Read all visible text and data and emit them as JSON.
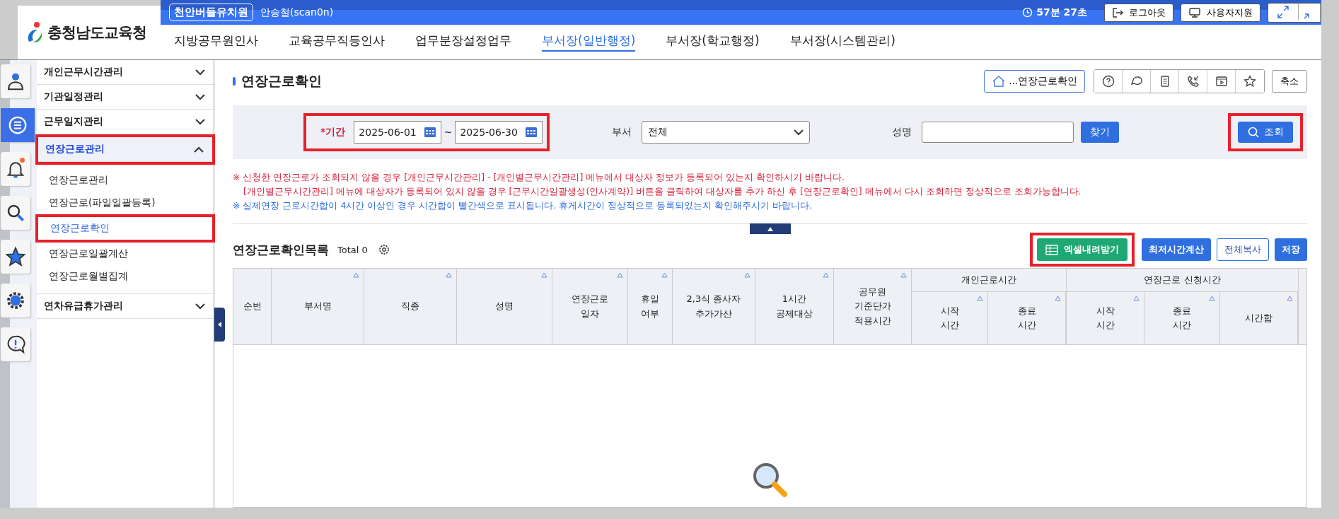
{
  "header": {
    "logo_text": "충청남도교육청",
    "org_badge": "천안버들유치원",
    "user": "안승철(scan0n)",
    "timer": "57분 27초",
    "buttons": [
      {
        "kind": "logout",
        "label": "로그아웃"
      },
      {
        "kind": "support",
        "label": "사용자지원"
      }
    ],
    "nav": [
      {
        "label": "지방공무원인사",
        "selected": false
      },
      {
        "label": "교육공무직등인사",
        "selected": false
      },
      {
        "label": "업무분장설정업무",
        "selected": false
      },
      {
        "label": "부서장(일반행정)",
        "selected": true
      },
      {
        "label": "부서장(학교행정)",
        "selected": false
      },
      {
        "label": "부서장(시스템관리)",
        "selected": false
      }
    ]
  },
  "rail": [
    {
      "kind": "person",
      "selected": false,
      "notification": false
    },
    {
      "kind": "list",
      "selected": true,
      "notification": false
    },
    {
      "kind": "bell",
      "selected": false,
      "notification": true
    },
    {
      "kind": "search",
      "selected": false,
      "notification": false
    },
    {
      "kind": "star",
      "selected": false,
      "notification": false
    },
    {
      "kind": "gear",
      "selected": false,
      "notification": false
    },
    {
      "kind": "alert",
      "selected": false,
      "notification": false
    }
  ],
  "menu": [
    {
      "label": "개인근무시간관리",
      "expanded": false,
      "highlighted": false
    },
    {
      "label": "기관일정관리",
      "expanded": false,
      "highlighted": false
    },
    {
      "label": "근무일지관리",
      "expanded": false,
      "highlighted": false
    },
    {
      "label": "연장근로관리",
      "expanded": true,
      "highlighted": true,
      "children": [
        {
          "label": "연장근로관리",
          "selected": false,
          "highlighted": false
        },
        {
          "label": "연장근로(파일일괄등록)",
          "selected": false,
          "highlighted": false
        },
        {
          "label": "연장근로확인",
          "selected": true,
          "highlighted": true
        },
        {
          "label": "연장근로일괄계산",
          "selected": false,
          "highlighted": false
        },
        {
          "label": "연장근로월별집계",
          "selected": false,
          "highlighted": false
        }
      ]
    },
    {
      "label": "연차유급휴가관리",
      "expanded": false,
      "highlighted": false
    }
  ],
  "page": {
    "title": "연장근로확인",
    "breadcrumb": "...연장근로확인",
    "collapse_button": "축소"
  },
  "search": {
    "period": {
      "label": "*기간",
      "start": "2025-06-01",
      "separator": "~",
      "end": "2025-06-30",
      "highlighted": true
    },
    "department": {
      "label": "부서",
      "value": "전체"
    },
    "name": {
      "label": "성명",
      "button": "찾기"
    },
    "query_button": {
      "label": "조회",
      "highlighted": true
    }
  },
  "notices": [
    {
      "text": "※ 신청한 연장근로가 조회되지 않을 경우 [개인근무시간관리] - [개인별근무시간관리] 메뉴에서 대상자 정보가 등록되어 있는지 확인하시기 바랍니다.",
      "color": "#d8243c"
    },
    {
      "text": "[개인별근무시간관리] 메뉴에 대상자가 등록되어 있지 않을 경우 [근무시간일괄생성(인사계약)] 버튼을 클릭하여 대상자를 추가 하신 후 [연장근로확인] 메뉴에서 다시 조회하면 정상적으로 조회가능합니다.",
      "color": "#d8243c"
    },
    {
      "text": "※ 실제연장 근로시간합이 4시간 이상인 경우 시간합이 빨간색으로 표시됩니다. 휴게시간이 정상적으로 등록되었는지 확인해주시기 바랍니다.",
      "color": "#2f6fe0"
    }
  ],
  "list": {
    "title": "연장근로확인목록",
    "total": "Total 0",
    "buttons": [
      {
        "kind": "excel",
        "label": "엑셀내려받기",
        "highlighted": true
      },
      {
        "kind": "primary",
        "label": "최저시간계산",
        "highlighted": false
      },
      {
        "kind": "outline",
        "label": "전체복사",
        "highlighted": false
      },
      {
        "kind": "primary",
        "label": "저장",
        "highlighted": false
      }
    ]
  },
  "table": {
    "columns": [
      {
        "label": "순번",
        "sortable": false
      },
      {
        "label": "부서명",
        "sortable": true
      },
      {
        "label": "직종",
        "sortable": true
      },
      {
        "label": "성명",
        "sortable": true
      },
      {
        "label": "연장근로\n일자",
        "sortable": true
      },
      {
        "label": "휴일\n여부",
        "sortable": true
      },
      {
        "label": "2,3식 종사자\n추가가산",
        "sortable": true
      },
      {
        "label": "1시간\n공제대상",
        "sortable": true
      },
      {
        "label": "공무원\n기준단가\n적용시간",
        "sortable": true
      },
      {
        "label": "개인근로시간",
        "children": [
          {
            "label": "시작\n시간",
            "sortable": true
          },
          {
            "label": "종료\n시간",
            "sortable": true
          }
        ]
      },
      {
        "label": "연장근로 신청시간",
        "children": [
          {
            "label": "시작\n시간",
            "sortable": true
          },
          {
            "label": "종료\n시간",
            "sortable": true
          },
          {
            "label": "시간합",
            "sortable": true
          }
        ]
      }
    ]
  }
}
